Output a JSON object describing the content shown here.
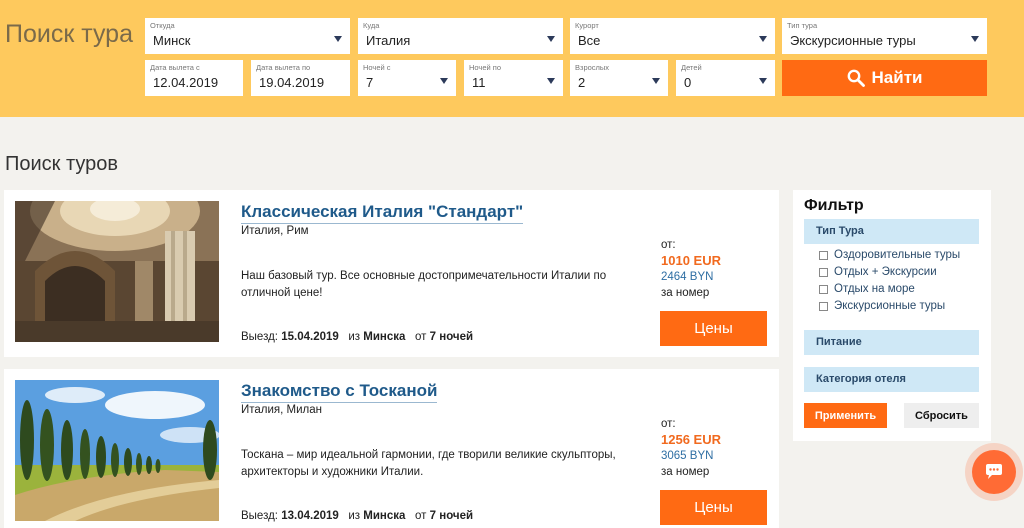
{
  "search": {
    "title": "Поиск тура",
    "from": {
      "label": "Откуда",
      "value": "Минск"
    },
    "to": {
      "label": "Куда",
      "value": "Италия"
    },
    "resort": {
      "label": "Курорт",
      "value": "Все"
    },
    "tour_type": {
      "label": "Тип тура",
      "value": "Экскурсионные туры"
    },
    "date_from": {
      "label": "Дата вылета с",
      "value": "12.04.2019"
    },
    "date_to": {
      "label": "Дата вылета по",
      "value": "19.04.2019"
    },
    "nights_from": {
      "label": "Ночей с",
      "value": "7"
    },
    "nights_to": {
      "label": "Ночей по",
      "value": "11"
    },
    "adults": {
      "label": "Взрослых",
      "value": "2"
    },
    "children": {
      "label": "Детей",
      "value": "0"
    },
    "find_label": "Найти"
  },
  "page_title": "Поиск туров",
  "tours": [
    {
      "title": "Классическая Италия \"Стандарт\"",
      "location": "Италия, Рим",
      "description": "Наш базовый тур. Все основные достопримечательности Италии по отличной цене!",
      "departure_label": "Выезд:",
      "departure_date": "15.04.2019",
      "from_label": "из",
      "from_city": "Минска",
      "nights_label": "от",
      "nights": "7 ночей",
      "price_from": "от:",
      "price_eur": "1010 EUR",
      "price_byn": "2464 BYN",
      "price_unit": "за номер",
      "button": "Цены"
    },
    {
      "title": "Знакомство с Тосканой",
      "location": "Италия, Милан",
      "description": "Тоскана – мир идеальной гармонии, где творили великие скульпторы, архитекторы и художники Италии.",
      "departure_label": "Выезд:",
      "departure_date": "13.04.2019",
      "from_label": "из",
      "from_city": "Минска",
      "nights_label": "от",
      "nights": "7 ночей",
      "price_from": "от:",
      "price_eur": "1256 EUR",
      "price_byn": "3065 BYN",
      "price_unit": "за номер",
      "button": "Цены"
    }
  ],
  "filter": {
    "title": "Фильтр",
    "type_section": "Тип Тура",
    "options": [
      "Оздоровительные туры",
      "Отдых + Экскурсии",
      "Отдых на море",
      "Экскурсионные туры"
    ],
    "meal_section": "Питание",
    "hotel_section": "Категория отеля",
    "apply": "Применить",
    "reset": "Сбросить"
  },
  "colors": {
    "header_bg": "#fec95d",
    "accent": "#ff6a13",
    "link": "#1f5a8a",
    "filter_section": "#cfe8f6"
  },
  "icons": {
    "find": "search-icon",
    "chat": "chat-icon",
    "dropdown": "chevron-down-icon"
  }
}
